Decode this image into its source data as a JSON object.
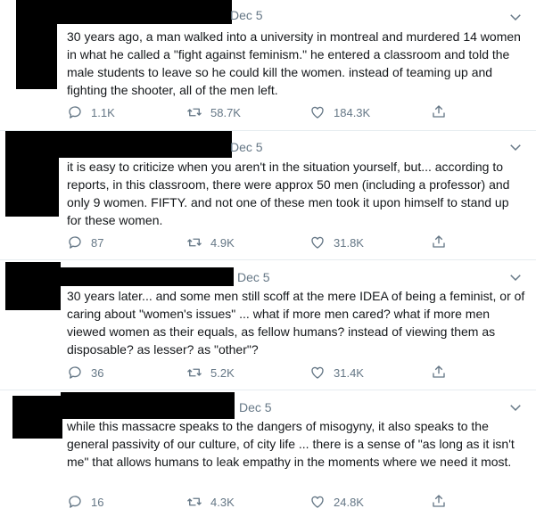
{
  "tweets": [
    {
      "date": "Dec 5",
      "text": "30 years ago, a man walked into a university in montreal and murdered 14 women in what he called a \"fight against feminism.\" he entered a classroom and told the male students to leave so he could kill the women. instead of teaming up and fighting the shooter, all of the men left.",
      "replies": "1.1K",
      "retweets": "58.7K",
      "likes": "184.3K"
    },
    {
      "date": "Dec 5",
      "text": "it is easy to criticize when you aren't in the situation yourself, but... according to reports, in this classroom, there were approx 50 men (including a professor) and only 9 women. FIFTY. and not one of these men took it upon himself to stand up for these women.",
      "replies": "87",
      "retweets": "4.9K",
      "likes": "31.8K"
    },
    {
      "date": "Dec 5",
      "text": "30 years later... and some men still scoff at the mere IDEA of being a feminist, or of caring about \"women's issues\" ... what if more men cared? what if more men viewed women as their equals, as fellow humans? instead of viewing them as disposable? as lesser? as \"other\"?",
      "replies": "36",
      "retweets": "5.2K",
      "likes": "31.4K"
    },
    {
      "date": "Dec 5",
      "text": "while this massacre speaks to the dangers of misogyny, it also speaks to the general passivity of our culture, of city life ... there is a sense of \"as long as it isn't me\" that allows humans to leak empathy in the moments where we need it most.",
      "replies": "16",
      "retweets": "4.3K",
      "likes": "24.8K"
    }
  ],
  "icons": {
    "reply": "reply-icon",
    "retweet": "retweet-icon",
    "like": "heart-icon",
    "share": "share-icon",
    "more": "chevron-down-icon"
  },
  "colors": {
    "text": "#14171a",
    "muted": "#657786",
    "border": "#e6ecf0",
    "redaction": "#000000"
  }
}
